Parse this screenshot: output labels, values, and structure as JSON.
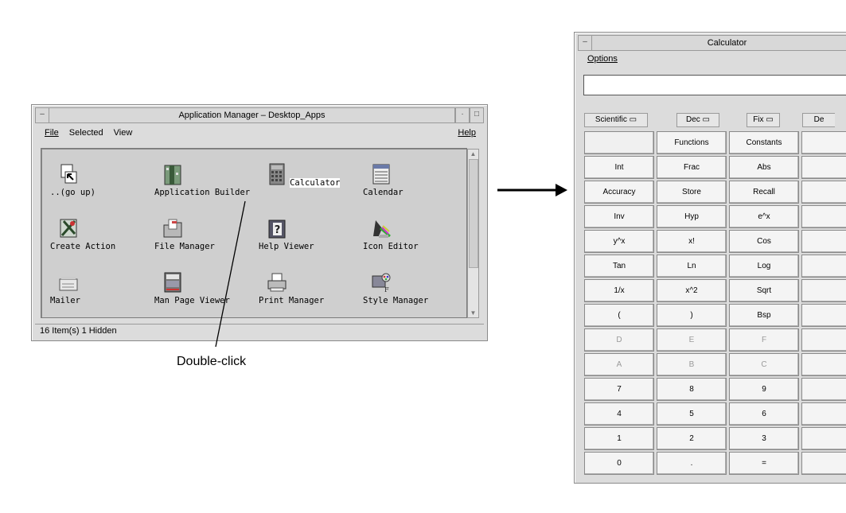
{
  "app_manager": {
    "title": "Application Manager – Desktop_Apps",
    "menu": {
      "file": "File",
      "selected": "Selected",
      "view": "View",
      "help": "Help"
    },
    "icons": [
      {
        "label": "..(go up)",
        "icon": "go-up-icon"
      },
      {
        "label": "Application Builder",
        "icon": "app-builder-icon"
      },
      {
        "label": "Calculator",
        "icon": "calculator-icon"
      },
      {
        "label": "Calendar",
        "icon": "calendar-icon"
      },
      {
        "label": "Create Action",
        "icon": "create-action-icon"
      },
      {
        "label": "File Manager",
        "icon": "file-manager-icon"
      },
      {
        "label": "Help Viewer",
        "icon": "help-viewer-icon"
      },
      {
        "label": "Icon Editor",
        "icon": "icon-editor-icon"
      },
      {
        "label": "Mailer",
        "icon": "mailer-icon"
      },
      {
        "label": "Man Page Viewer",
        "icon": "man-page-icon"
      },
      {
        "label": "Print Manager",
        "icon": "printer-icon"
      },
      {
        "label": "Style Manager",
        "icon": "style-manager-icon"
      }
    ],
    "status": "16 Item(s) 1 Hidden"
  },
  "annotation": {
    "label": "Double-click"
  },
  "calculator": {
    "title": "Calculator",
    "menu": {
      "options": "Options"
    },
    "display_value": "",
    "modes": [
      "Scientific",
      "Dec",
      "Fix",
      "De"
    ],
    "keys": [
      [
        "",
        "Functions",
        "Constants"
      ],
      [
        "Int",
        "Frac",
        "Abs"
      ],
      [
        "Accuracy",
        "Store",
        "Recall"
      ],
      [
        "Inv",
        "Hyp",
        "e^x"
      ],
      [
        "y^x",
        "x!",
        "Cos"
      ],
      [
        "Tan",
        "Ln",
        "Log"
      ],
      [
        "1/x",
        "x^2",
        "Sqrt"
      ],
      [
        "(",
        ")",
        "Bsp"
      ],
      [
        "D",
        "E",
        "F"
      ],
      [
        "A",
        "B",
        "C"
      ],
      [
        "7",
        "8",
        "9"
      ],
      [
        "4",
        "5",
        "6"
      ],
      [
        "1",
        "2",
        "3"
      ],
      [
        "0",
        ".",
        "="
      ]
    ]
  }
}
